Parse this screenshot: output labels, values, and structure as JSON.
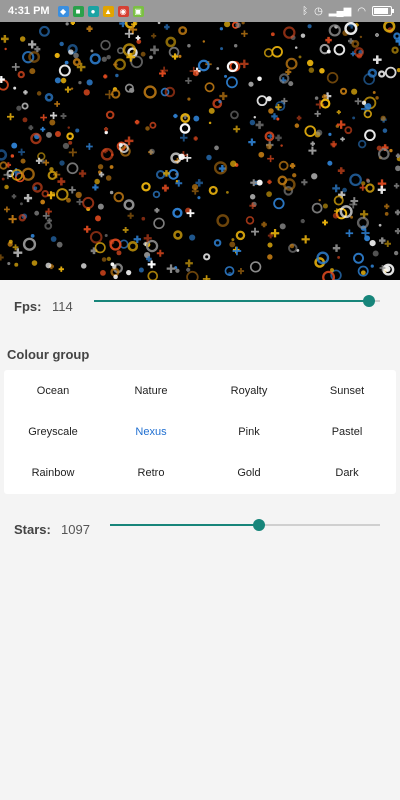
{
  "status_bar": {
    "time": "4:31 PM",
    "left_icons": [
      {
        "name": "security-shield-icon",
        "color": "#3a8fe0"
      },
      {
        "name": "wallet-app-icon",
        "color": "#2aa14b"
      },
      {
        "name": "chat-app-icon",
        "color": "#1aa3a3"
      },
      {
        "name": "maps-icon",
        "color": "#e2a400"
      },
      {
        "name": "google-icon",
        "color": "#d64033"
      },
      {
        "name": "android-robot-icon",
        "color": "#7bc043"
      }
    ],
    "right_icons": [
      "bluetooth-icon",
      "alarm-icon",
      "signal-icon",
      "wifi-icon"
    ],
    "battery_level": 0.85
  },
  "starfield": {
    "star_colors": [
      "#e9b20e",
      "#2e7fd0",
      "#e04a1f",
      "#ffffff",
      "#8c8c8c",
      "#c07a13"
    ]
  },
  "fps": {
    "label": "Fps:",
    "value": "114",
    "slider_fraction": 0.96
  },
  "colour_group": {
    "title": "Colour group",
    "selected": "Nexus",
    "options": [
      "Ocean",
      "Nature",
      "Royalty",
      "Sunset",
      "Greyscale",
      "Nexus",
      "Pink",
      "Pastel",
      "Rainbow",
      "Retro",
      "Gold",
      "Dark"
    ]
  },
  "stars": {
    "label": "Stars:",
    "value": "1097",
    "slider_fraction": 0.55
  },
  "accent_color": "#17857a",
  "selected_color": "#1f6fd1"
}
